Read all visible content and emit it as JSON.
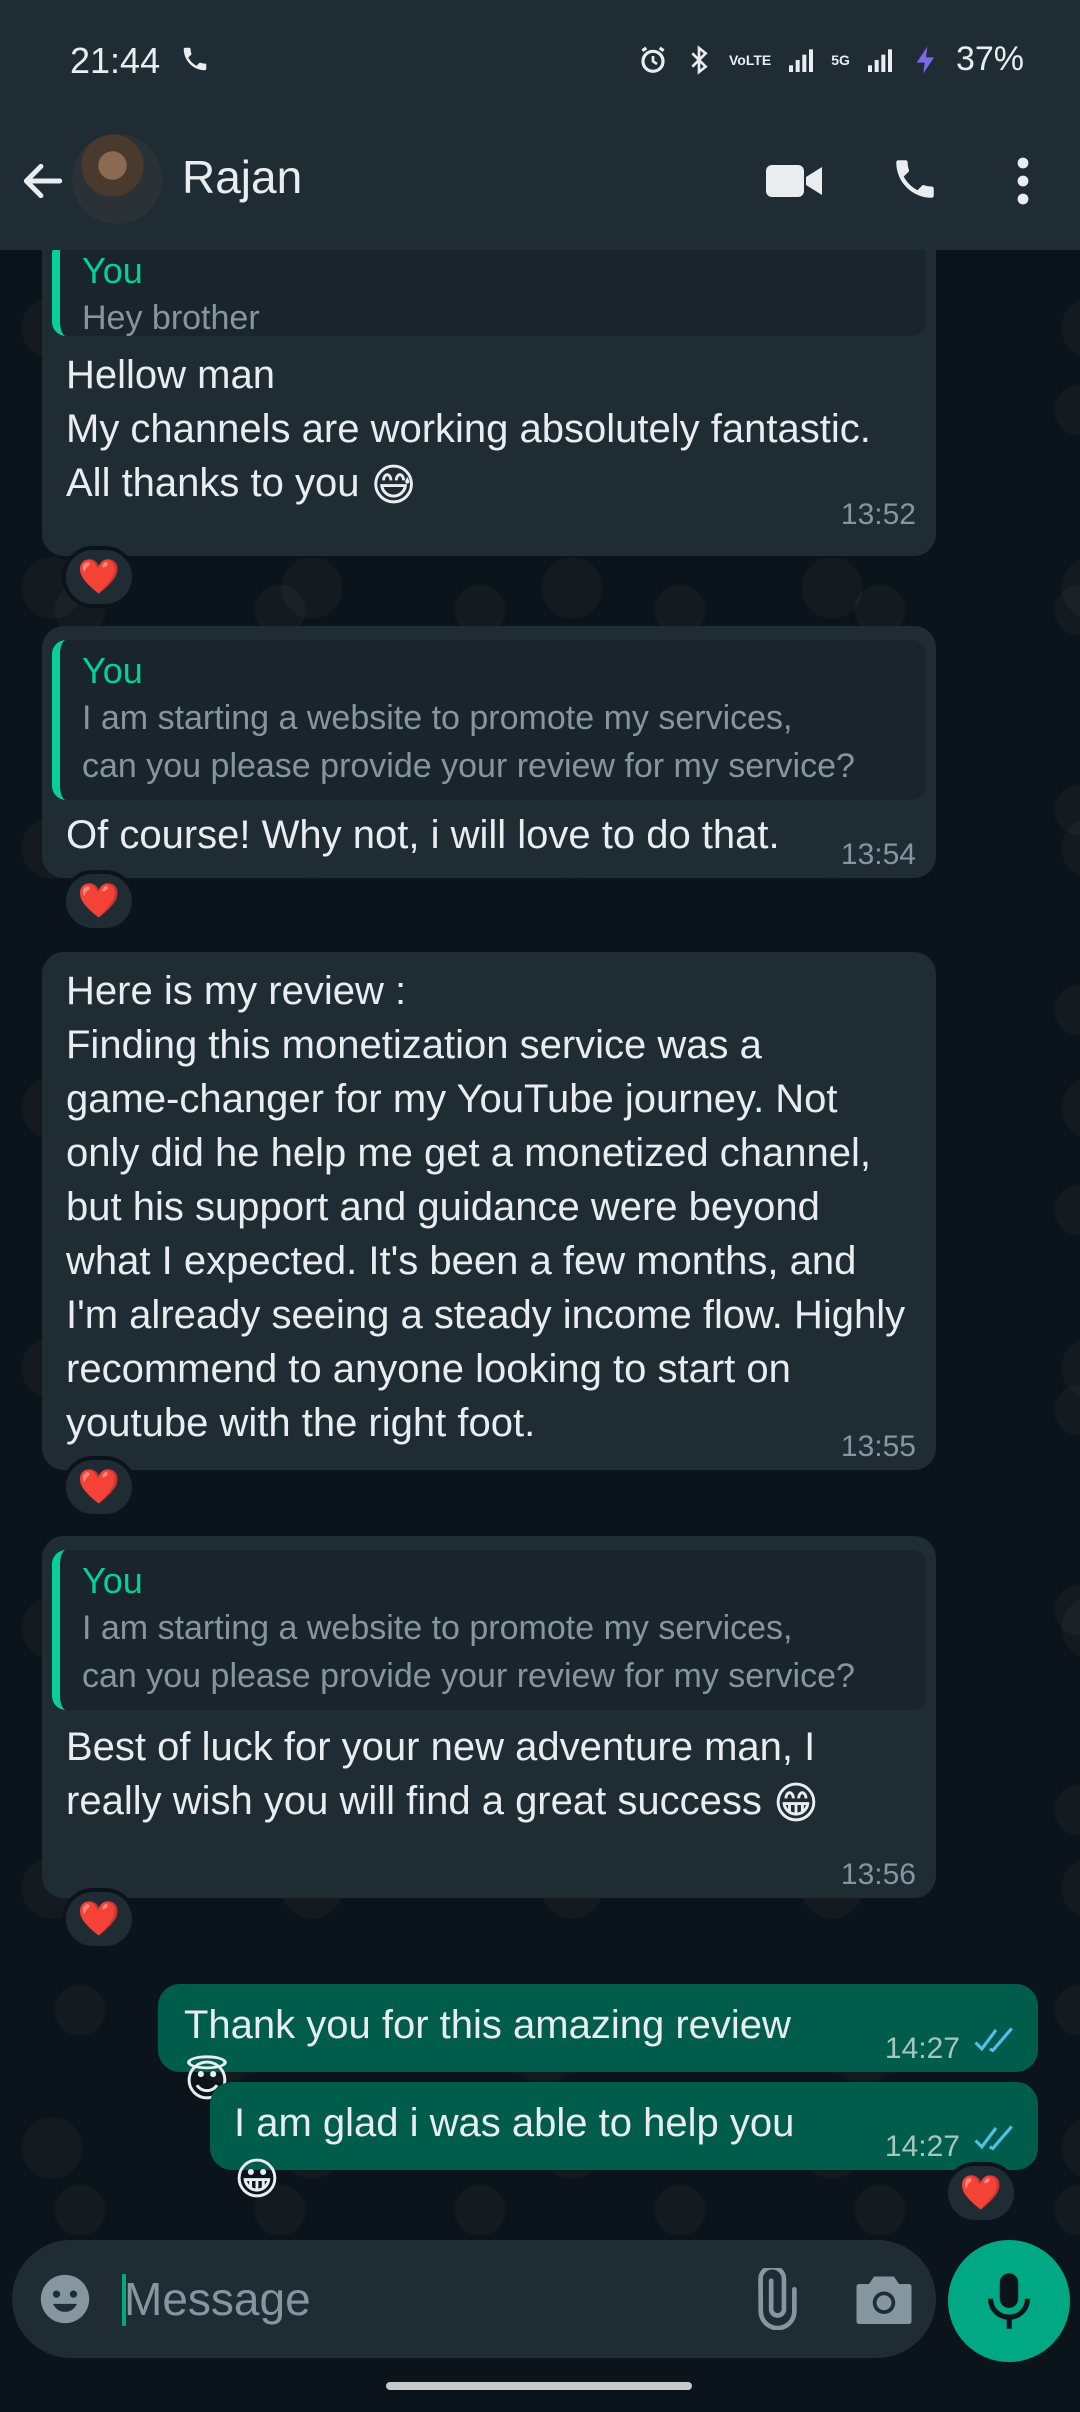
{
  "status_bar": {
    "time": "21:44",
    "network_label": "5G",
    "lte_label": "VoLTE",
    "battery": "37%"
  },
  "header": {
    "contact_name": "Rajan"
  },
  "messages": [
    {
      "direction": "in",
      "quote": {
        "name": "You",
        "text": "Hey brother"
      },
      "text": "Hellow man\nMy channels are working absolutely fantastic.\nAll thanks to you",
      "emoji": "😅",
      "time": "13:52",
      "reaction": "❤️"
    },
    {
      "direction": "in",
      "quote": {
        "name": "You",
        "text": "I am starting a website to promote my services,\ncan you please provide your review for my service?"
      },
      "text": "Of course! Why not, i will love to do that.",
      "time": "13:54",
      "reaction": "❤️"
    },
    {
      "direction": "in",
      "text": "Here is my review :\nFinding this monetization service was a\ngame-changer for my YouTube journey. Not\nonly did he help me get a monetized channel,\nbut his support and guidance were beyond\nwhat I expected. It's been a few months, and\nI'm already seeing a steady income flow. Highly\nrecommend to anyone looking to start on\nyoutube with the right foot.",
      "time": "13:55",
      "reaction": "❤️"
    },
    {
      "direction": "in",
      "quote": {
        "name": "You",
        "text": "I am starting a website to promote my services,\ncan you please provide your review for my service?"
      },
      "text": "Best of luck for your new adventure man, I\nreally wish you will find a great success",
      "emoji": "😁",
      "time": "13:56",
      "reaction": "❤️"
    },
    {
      "direction": "out",
      "text": "Thank you for this amazing review",
      "emoji": "😇",
      "time": "14:27",
      "status": "read"
    },
    {
      "direction": "out",
      "text": "I am glad i was able to help you",
      "emoji": "😀",
      "time": "14:27",
      "status": "read",
      "reaction": "❤️"
    }
  ],
  "composer": {
    "placeholder": "Message"
  },
  "colors": {
    "accent": "#00a884",
    "incoming_bubble": "#1f2c34",
    "outgoing_bubble": "#005c4b",
    "read_ticks": "#53bdeb"
  }
}
